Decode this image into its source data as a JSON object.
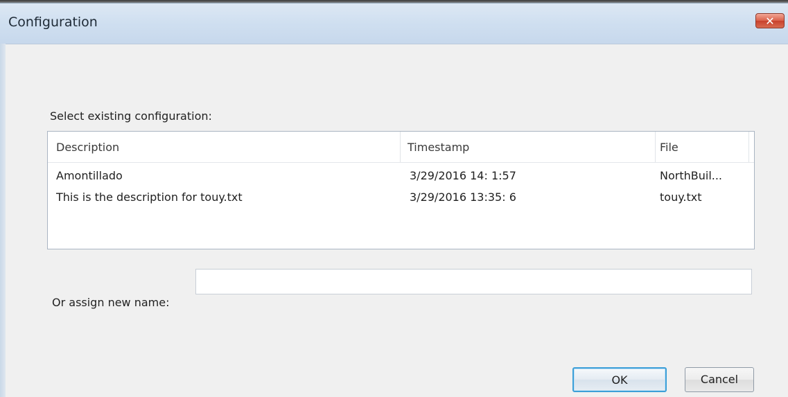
{
  "window": {
    "title": "Configuration",
    "close_glyph": "✕"
  },
  "select_label": "Select existing configuration:",
  "list": {
    "columns": [
      "Description",
      "Timestamp",
      "File"
    ],
    "rows": [
      {
        "description": "Amontillado",
        "timestamp": "3/29/2016 14: 1:57",
        "file": "NorthBuil..."
      },
      {
        "description": "This is the description for touy.txt",
        "timestamp": "3/29/2016 13:35: 6",
        "file": "touy.txt"
      }
    ]
  },
  "new_name": {
    "label": "Or assign new name:",
    "value": "",
    "placeholder": ""
  },
  "buttons": {
    "ok": "OK",
    "cancel": "Cancel"
  },
  "colors": {
    "focus_border": "#3c9fd8",
    "close_button": "#c8412c",
    "titlebar": "#cfdff0"
  }
}
